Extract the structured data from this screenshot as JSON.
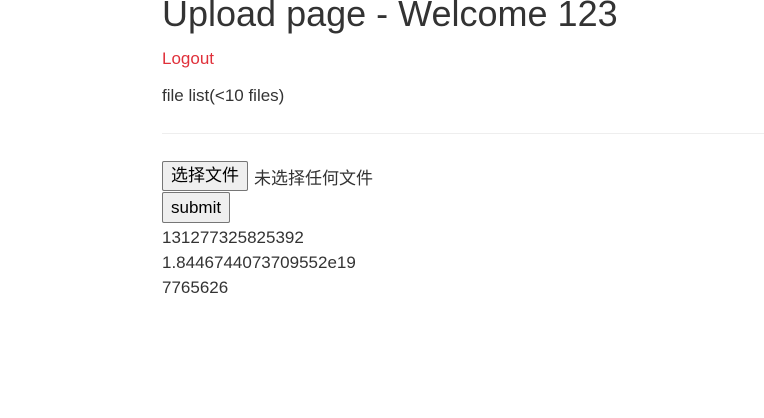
{
  "header": {
    "title": "Upload page - Welcome 123",
    "logout_label": "Logout"
  },
  "file_list_label": "file list(<10 files)",
  "upload": {
    "choose_button_label": "选择文件",
    "no_file_selected": "未选择任何文件",
    "submit_label": "submit"
  },
  "files": [
    "131277325825392",
    "1.8446744073709552e19",
    "7765626"
  ],
  "colors": {
    "link": "#e0303a",
    "text": "#333333",
    "divider": "#eeeeee",
    "button_bg": "#efefef"
  }
}
